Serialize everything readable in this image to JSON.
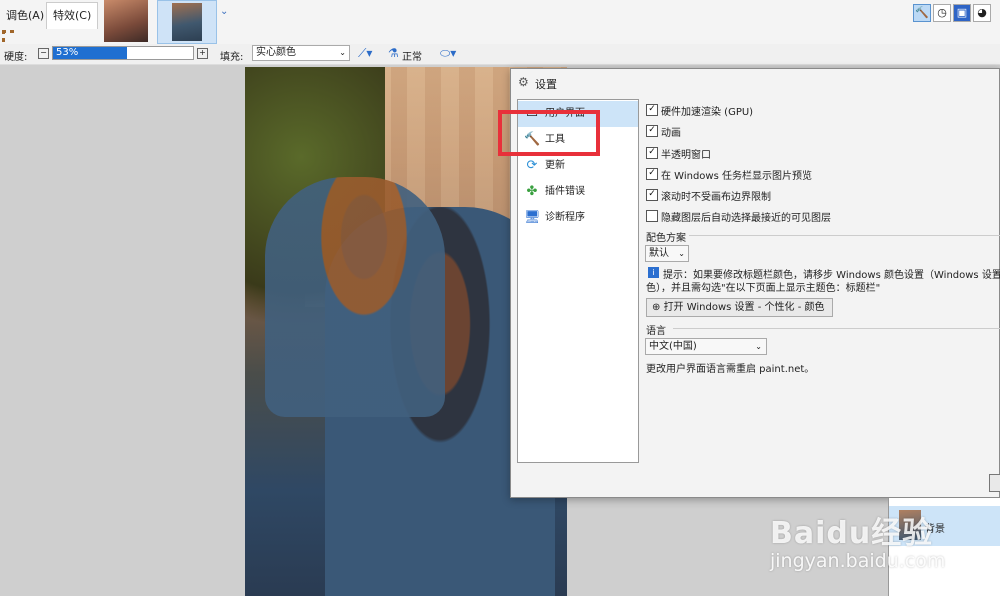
{
  "menubar": {
    "adjustments": "调色(A)",
    "effects": "特效(C)",
    "tab_dropdown": "⌄"
  },
  "toolbar": {
    "hardness_label": "硬度:",
    "hardness_value": "53%",
    "hardness_fraction": 0.53,
    "fill_label": "填充:",
    "fill_value": "实心颜色",
    "blend_label": "正常"
  },
  "settings": {
    "title": "设置",
    "nav": [
      {
        "label": "用户界面",
        "icon": "ui-window-icon"
      },
      {
        "label": "工具",
        "icon": "hammer-icon"
      },
      {
        "label": "更新",
        "icon": "update-icon"
      },
      {
        "label": "插件错误",
        "icon": "puzzle-icon"
      },
      {
        "label": "诊断程序",
        "icon": "diagnostics-icon"
      }
    ],
    "options": [
      {
        "label": "硬件加速渲染 (GPU)",
        "checked": true
      },
      {
        "label": "动画",
        "checked": true
      },
      {
        "label": "半透明窗口",
        "checked": true
      },
      {
        "label": "在 Windows 任务栏显示图片预览",
        "checked": true
      },
      {
        "label": "滚动时不受画布边界限制",
        "checked": true
      },
      {
        "label": "隐藏图层后自动选择最接近的可见图层",
        "checked": false
      }
    ],
    "theme_heading": "配色方案",
    "theme_value": "默认",
    "tip_line1": "提示：如果要修改标题栏颜色，请移步 Windows 颜色设置（Windows 设置 -",
    "tip_line2": "色），并且需勾选\"在以下页面上显示主题色：标题栏\"",
    "open_windows_settings": "打开 Windows 设置 - 个性化 - 颜色",
    "language_heading": "语言",
    "language_value": "中文(中国)",
    "restart_note": "更改用户界面语言需重启 paint.net。"
  },
  "layers": {
    "layer_name": "背景"
  },
  "watermark": {
    "logo": "Baidu经验",
    "url": "jingyan.baidu.com"
  },
  "colors": {
    "highlight": "#e8303a",
    "accent": "#1f6fd1",
    "selected_bg": "#cde4f8"
  }
}
